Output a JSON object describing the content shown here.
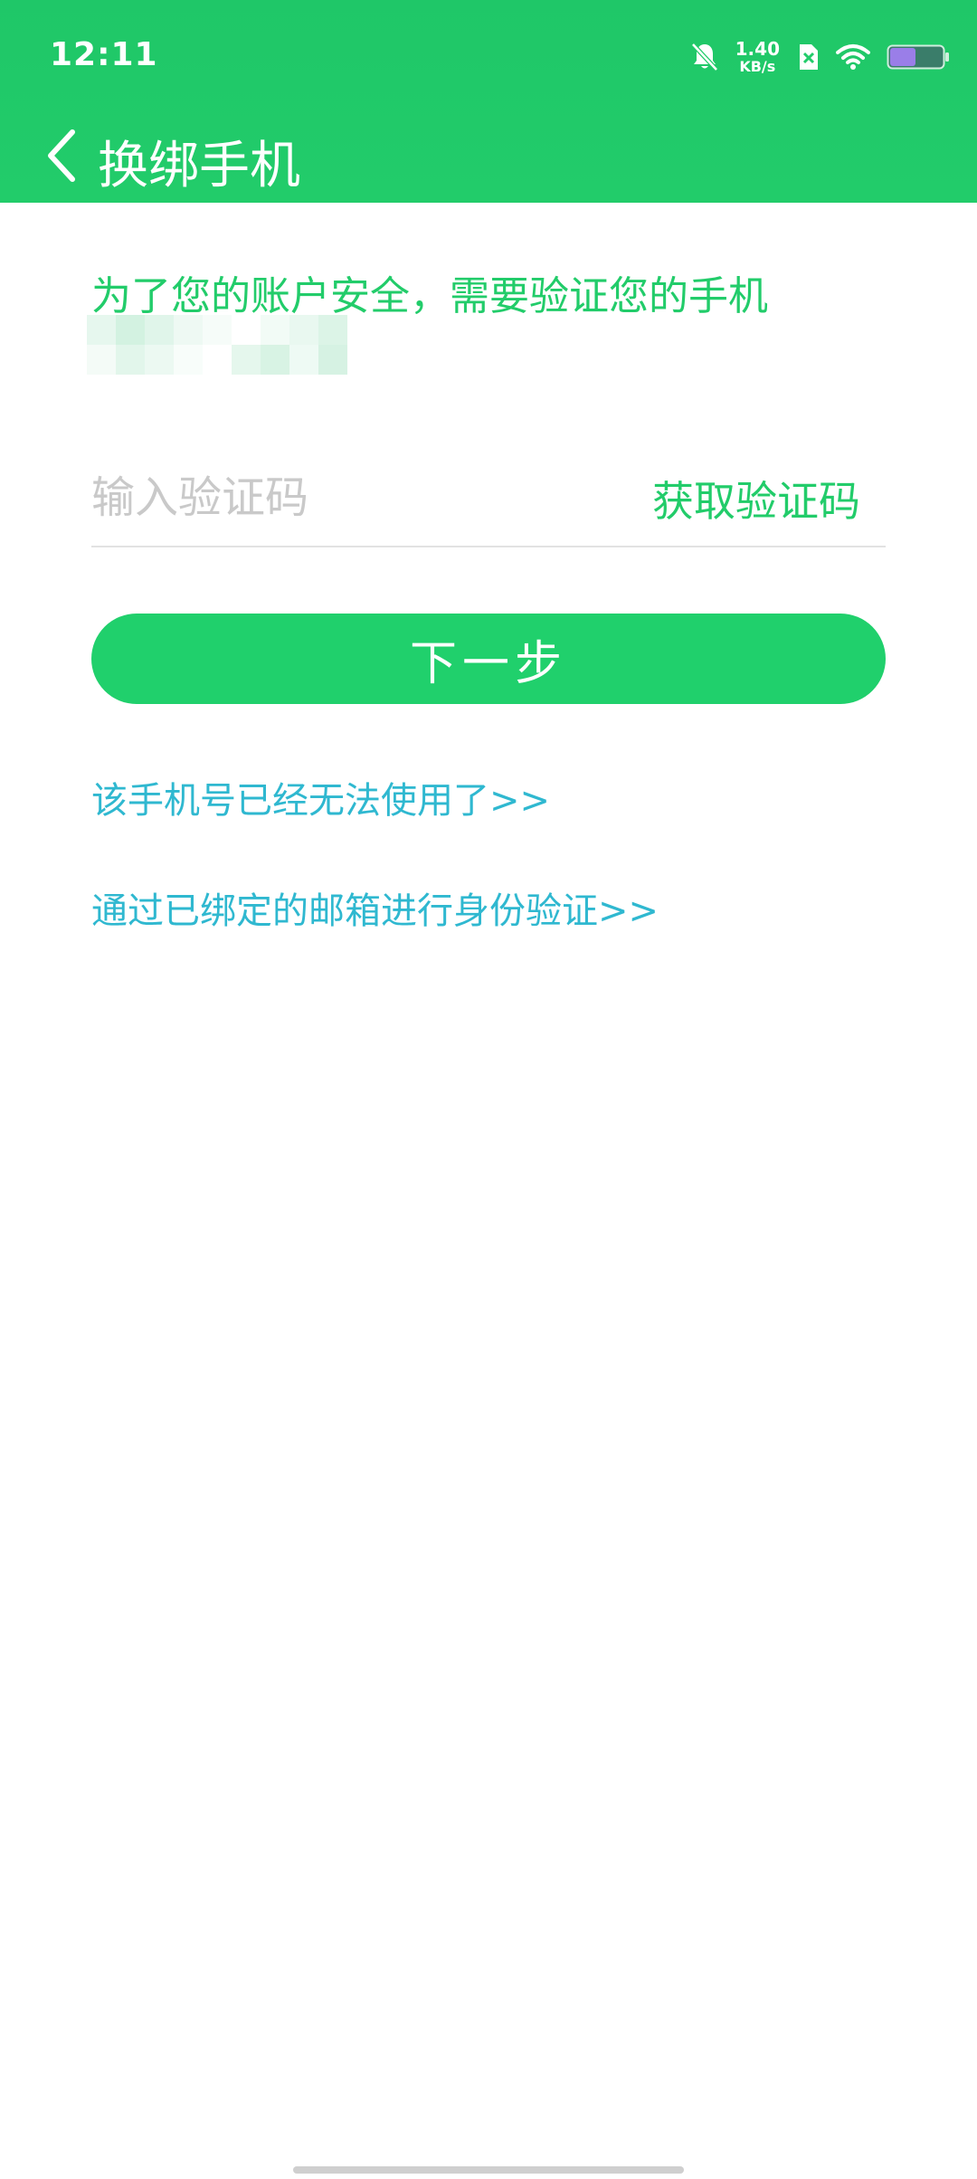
{
  "status_bar": {
    "time": "12:11",
    "net_speed_value": "1.40",
    "net_speed_unit": "KB/s",
    "icons": [
      "bell-off-icon",
      "net-speed",
      "sim-x-icon",
      "wifi-icon",
      "battery-icon"
    ]
  },
  "app_bar": {
    "back_icon": "chevron-left-icon",
    "title": "换绑手机"
  },
  "content": {
    "notice": "为了您的账户安全，需要验证您的手机",
    "code_input": {
      "placeholder": "输入验证码",
      "value": ""
    },
    "get_code_label": "获取验证码",
    "next_label": "下一步",
    "link_phone_unusable": "该手机号已经无法使用了>>",
    "link_email_verify": "通过已绑定的邮箱进行身份验证>>"
  },
  "colors": {
    "brand_green": "#22cc6a",
    "link_blue": "#2fb8d0",
    "placeholder_gray": "#c9c9c9"
  }
}
